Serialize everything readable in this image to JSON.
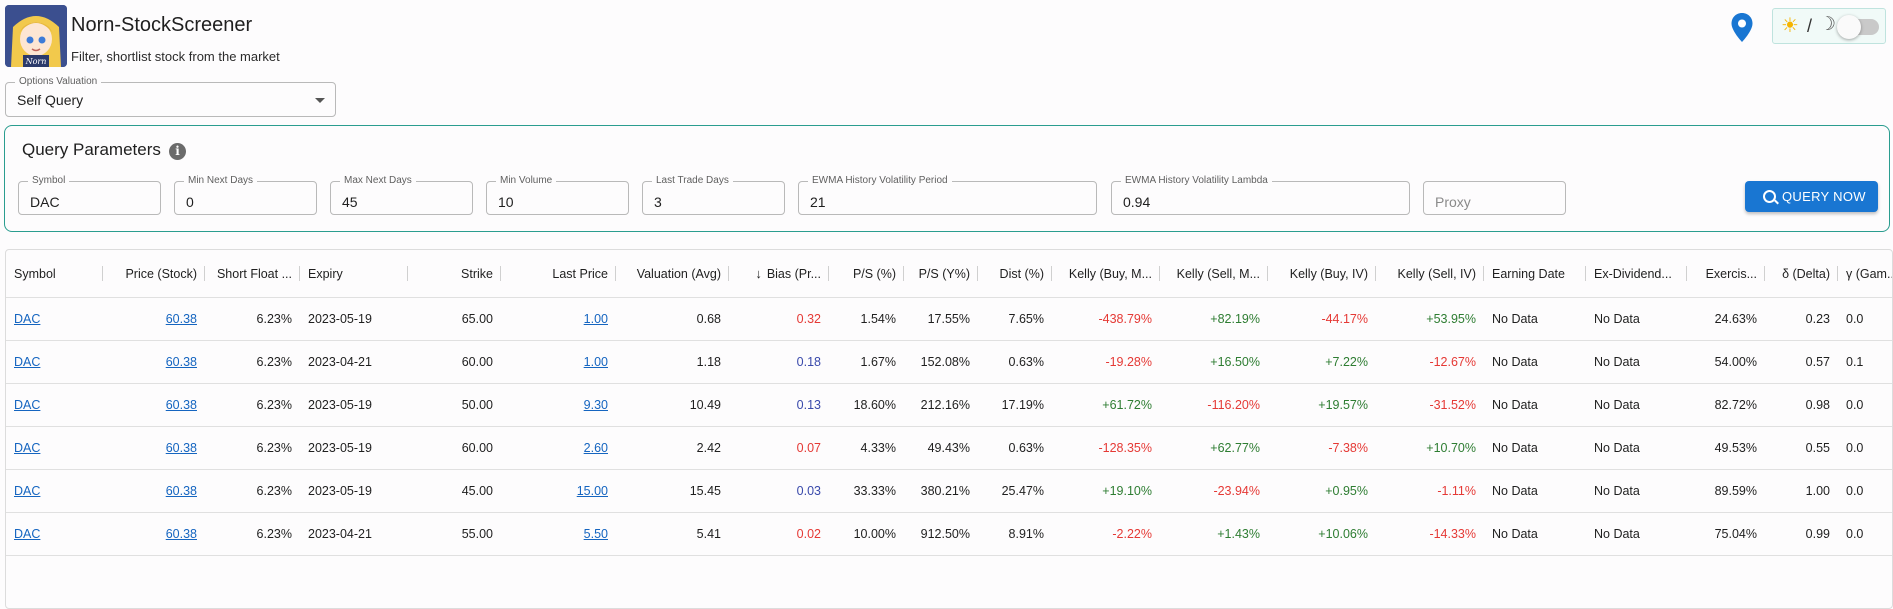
{
  "app": {
    "title": "Norn-StockScreener",
    "subtitle": "Filter, shortlist stock from the market",
    "logo_text": "Norn"
  },
  "theme_toggle": {
    "sun_icon": "☀",
    "slash": "/",
    "moon_icon": "☽",
    "dark_mode": false
  },
  "options_valuation": {
    "label": "Options Valuation",
    "value": "Self Query"
  },
  "query_parameters": {
    "title": "Query Parameters",
    "fields": [
      {
        "label": "Symbol",
        "value": "DAC"
      },
      {
        "label": "Min Next Days",
        "value": "0"
      },
      {
        "label": "Max Next Days",
        "value": "45"
      },
      {
        "label": "Min Volume",
        "value": "10"
      },
      {
        "label": "Last Trade Days",
        "value": "3"
      },
      {
        "label": "EWMA History Volatility Period",
        "value": "21"
      },
      {
        "label": "EWMA History Volatility Lambda",
        "value": "0.94"
      },
      {
        "label": "",
        "value": "",
        "placeholder": "Proxy"
      }
    ],
    "query_button": "QUERY NOW"
  },
  "table": {
    "columns": [
      "Symbol",
      "Price (Stock)",
      "Short Float ...",
      "Expiry",
      "Strike",
      "Last Price",
      "Valuation (Avg)",
      "Bias (Pr...",
      "P/S (%)",
      "P/S (Y%)",
      "Dist (%)",
      "Kelly (Buy, M...",
      "Kelly (Sell, M...",
      "Kelly (Buy, IV)",
      "Kelly (Sell, IV)",
      "Earning Date",
      "Ex-Dividend...",
      "Exercis...",
      "δ (Delta)",
      "γ (Gam..."
    ],
    "sort_arrow": "↓",
    "rows": [
      [
        "DAC",
        "60.38",
        "6.23%",
        "2023-05-19",
        "65.00",
        "1.00",
        "0.68",
        "0.32",
        "1.54%",
        "17.55%",
        "7.65%",
        "-438.79%",
        "+82.19%",
        "-44.17%",
        "+53.95%",
        "No Data",
        "No Data",
        "24.63%",
        "0.23",
        "0.0"
      ],
      [
        "DAC",
        "60.38",
        "6.23%",
        "2023-04-21",
        "60.00",
        "1.00",
        "1.18",
        "0.18",
        "1.67%",
        "152.08%",
        "0.63%",
        "-19.28%",
        "+16.50%",
        "+7.22%",
        "-12.67%",
        "No Data",
        "No Data",
        "54.00%",
        "0.57",
        "0.1"
      ],
      [
        "DAC",
        "60.38",
        "6.23%",
        "2023-05-19",
        "50.00",
        "9.30",
        "10.49",
        "0.13",
        "18.60%",
        "212.16%",
        "17.19%",
        "+61.72%",
        "-116.20%",
        "+19.57%",
        "-31.52%",
        "No Data",
        "No Data",
        "82.72%",
        "0.98",
        "0.0"
      ],
      [
        "DAC",
        "60.38",
        "6.23%",
        "2023-05-19",
        "60.00",
        "2.60",
        "2.42",
        "0.07",
        "4.33%",
        "49.43%",
        "0.63%",
        "-128.35%",
        "+62.77%",
        "-7.38%",
        "+10.70%",
        "No Data",
        "No Data",
        "49.53%",
        "0.55",
        "0.0"
      ],
      [
        "DAC",
        "60.38",
        "6.23%",
        "2023-05-19",
        "45.00",
        "15.00",
        "15.45",
        "0.03",
        "33.33%",
        "380.21%",
        "25.47%",
        "+19.10%",
        "-23.94%",
        "+0.95%",
        "-1.11%",
        "No Data",
        "No Data",
        "89.59%",
        "1.00",
        "0.0"
      ],
      [
        "DAC",
        "60.38",
        "6.23%",
        "2023-04-21",
        "55.00",
        "5.50",
        "5.41",
        "0.02",
        "10.00%",
        "912.50%",
        "8.91%",
        "-2.22%",
        "+1.43%",
        "+10.06%",
        "-14.33%",
        "No Data",
        "No Data",
        "75.04%",
        "0.99",
        "0.0"
      ]
    ],
    "bias_colors": [
      "red",
      "blue",
      "blue",
      "red",
      "blue",
      "red"
    ]
  },
  "colors": {
    "accent": "#1976d2",
    "panel_border": "#2a9d8f",
    "negative": "#e53935",
    "positive": "#2e7d32",
    "bias_blue": "#3949ab"
  }
}
